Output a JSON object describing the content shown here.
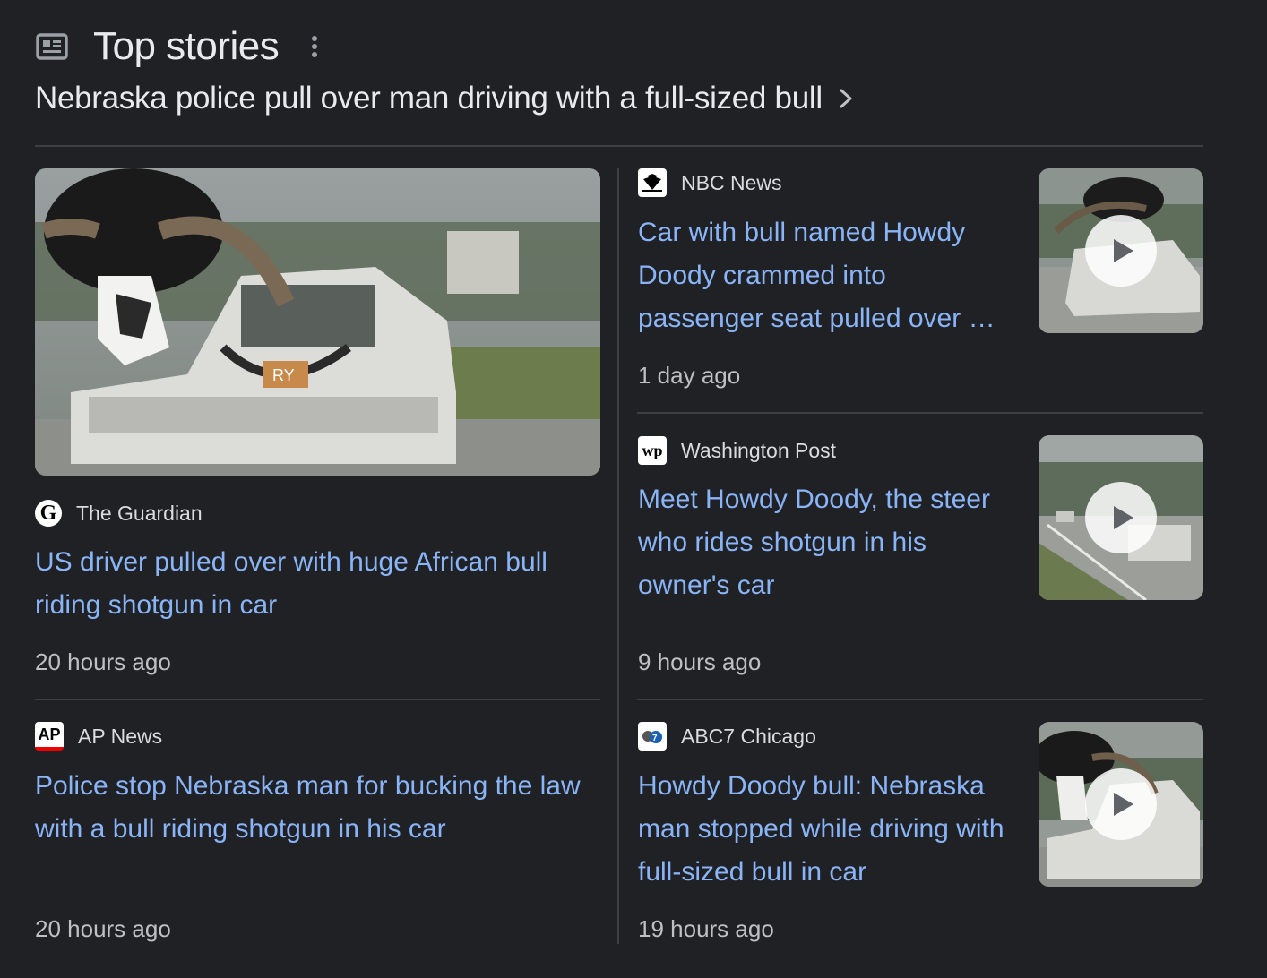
{
  "header": {
    "title": "Top stories",
    "subtitle": "Nebraska police pull over man driving with a full-sized bull"
  },
  "stories": [
    {
      "source": "The Guardian",
      "favicon_text": "G",
      "headline": "US driver pulled over with huge African bull riding shotgun in car",
      "time": "20 hours ago"
    },
    {
      "source": "NBC News",
      "favicon_text": "",
      "headline": "Car with bull named Howdy Doody crammed into passenger seat pulled over by Nebraska police",
      "time": "1 day ago"
    },
    {
      "source": "Washington Post",
      "favicon_text": "wp",
      "headline": "Meet Howdy Doody, the steer who rides shotgun in his owner's car",
      "time": "9 hours ago"
    },
    {
      "source": "AP News",
      "favicon_text": "AP",
      "headline": "Police stop Nebraska man for bucking the law with a bull riding shotgun in his car",
      "time": "20 hours ago"
    },
    {
      "source": "ABC7 Chicago",
      "favicon_text": "",
      "headline": "Howdy Doody bull: Nebraska man stopped while driving with full-sized bull in car",
      "time": "19 hours ago"
    }
  ],
  "plate_text": "RY",
  "colors": {
    "background": "#202124",
    "link": "#8ab4f8",
    "text": "#e8eaed",
    "muted": "#bdc1c6",
    "divider": "#3c4043"
  }
}
